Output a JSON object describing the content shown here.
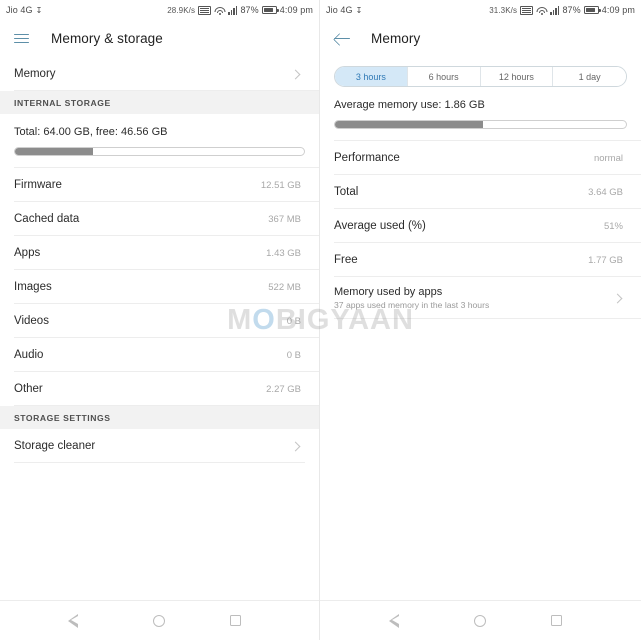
{
  "status_bar": {
    "carrier": "Jio 4G",
    "left_speed": "28.9K/s",
    "right_speed": "31.3K/s",
    "battery_percent": "87%",
    "time": "4:09 pm",
    "icons": [
      "download-icon",
      "volte-icon",
      "wifi-icon",
      "signal-icon",
      "battery-icon"
    ]
  },
  "watermark": {
    "part1": "M",
    "part_o": "O",
    "part2": "BIGYAAN",
    "full": "MOBIGYAAN"
  },
  "left_screen": {
    "appbar": {
      "menu_icon": "hamburger-icon",
      "title": "Memory & storage"
    },
    "memory_row": {
      "label": "Memory",
      "chevron": "chevron-right-icon"
    },
    "internal_storage": {
      "section_title": "INTERNAL STORAGE",
      "totals_text": "Total: 64.00 GB, free: 46.56 GB",
      "bar_percent": 27,
      "items": [
        {
          "label": "Firmware",
          "value": "12.51 GB"
        },
        {
          "label": "Cached data",
          "value": "367 MB"
        },
        {
          "label": "Apps",
          "value": "1.43 GB"
        },
        {
          "label": "Images",
          "value": "522 MB"
        },
        {
          "label": "Videos",
          "value": "0 B"
        },
        {
          "label": "Audio",
          "value": "0 B"
        },
        {
          "label": "Other",
          "value": "2.27 GB"
        }
      ]
    },
    "storage_settings": {
      "section_title": "STORAGE SETTINGS",
      "items": [
        {
          "label": "Storage cleaner",
          "chevron": "chevron-right-icon"
        }
      ]
    }
  },
  "right_screen": {
    "appbar": {
      "back_icon": "back-arrow-icon",
      "title": "Memory"
    },
    "tabs": [
      {
        "label": "3 hours",
        "active": true
      },
      {
        "label": "6 hours",
        "active": false
      },
      {
        "label": "12 hours",
        "active": false
      },
      {
        "label": "1 day",
        "active": false
      }
    ],
    "average_memory_use": "Average memory use: 1.86 GB",
    "bar_percent": 51,
    "rows": [
      {
        "label": "Performance",
        "value": "normal"
      },
      {
        "label": "Total",
        "value": "3.64 GB"
      },
      {
        "label": "Average used (%)",
        "value": "51%"
      },
      {
        "label": "Free",
        "value": "1.77 GB"
      }
    ],
    "memory_used_by_apps": {
      "label": "Memory used by apps",
      "sub": "37 apps used memory in the last 3 hours",
      "chevron": "chevron-right-icon"
    }
  },
  "nav_bar": {
    "back": "back-nav-icon",
    "home": "home-nav-icon",
    "recents": "recents-nav-icon"
  },
  "colors": {
    "accent": "#5d8fa8",
    "tab_active_bg": "#d4e8f7",
    "tab_active_text": "#2f79b5",
    "bar_fill": "#8c8c8c",
    "section_bg": "#f2f2f2"
  }
}
